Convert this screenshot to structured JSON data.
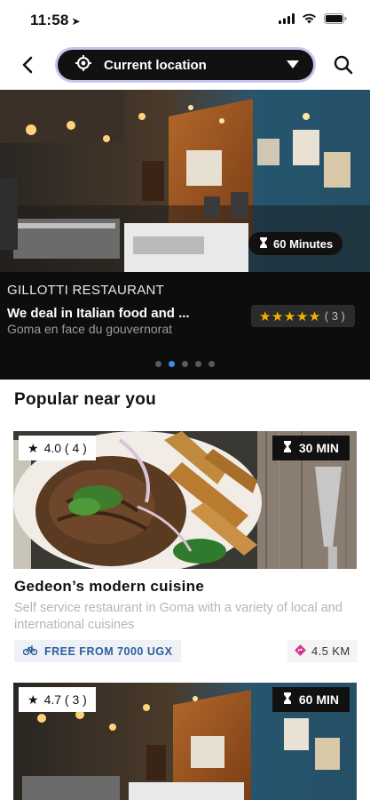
{
  "status_bar": {
    "time": "11:58",
    "time_icon": "location-arrow-icon"
  },
  "nav": {
    "back_icon": "back-chevron-icon",
    "location_label": "Current location",
    "location_icon": "crosshair-icon",
    "dropdown_icon": "caret-down-icon",
    "search_icon": "search-icon",
    "pill_border_color": "#c9c4ef"
  },
  "hero": {
    "time_label": "60 Minutes",
    "restaurant_name": "GILLOTTI RESTAURANT",
    "tagline": "We deal in Italian food and ...",
    "address": "Goma en face du gouvernorat",
    "rating_stars": 5,
    "rating_count": "( 3 )",
    "star_color": "#f5b301",
    "carousel": {
      "total": 5,
      "active": 1
    },
    "active_dot_color": "#3d8de8"
  },
  "section": {
    "title": "Popular near you"
  },
  "cards": [
    {
      "rating": "4.0 ( 4 )",
      "time": "30 MIN",
      "title": "Gedeon’s modern cuisine",
      "description": "Self service restaurant in Goma with a variety of local and international cuisines",
      "delivery": "FREE FROM 7000 UGX",
      "delivery_icon": "bicycle-icon",
      "distance": "4.5 KM",
      "distance_icon": "directions-icon",
      "distance_icon_color": "#d6338a"
    },
    {
      "rating": "4.7 ( 3 )",
      "time": "60 MIN"
    }
  ]
}
